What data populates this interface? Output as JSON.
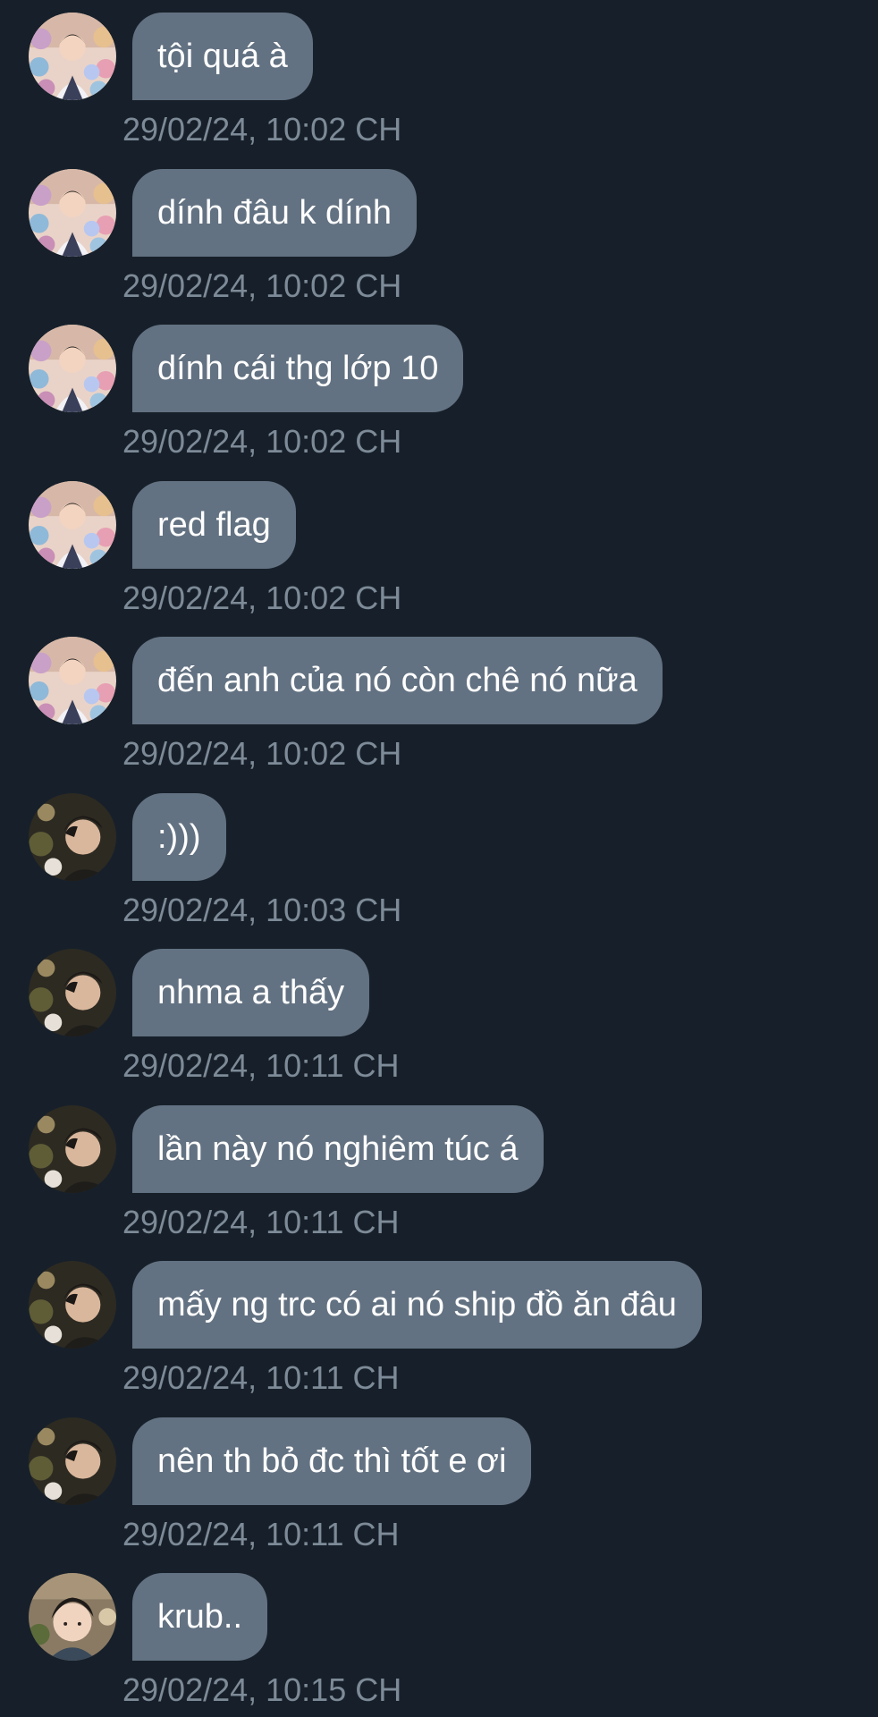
{
  "colors": {
    "background": "#17202a",
    "bubble": "#637282",
    "bubble_text": "#ffffff",
    "timestamp": "#7d8a97"
  },
  "messages": [
    {
      "avatar": "avatar-a",
      "text": "tội quá à",
      "time": "29/02/24, 10:02 CH"
    },
    {
      "avatar": "avatar-a",
      "text": "dính đâu k dính",
      "time": "29/02/24, 10:02 CH"
    },
    {
      "avatar": "avatar-a",
      "text": "dính cái thg lớp 10",
      "time": "29/02/24, 10:02 CH"
    },
    {
      "avatar": "avatar-a",
      "text": "red flag",
      "time": "29/02/24, 10:02 CH"
    },
    {
      "avatar": "avatar-a",
      "text": "đến anh của nó còn chê nó nữa",
      "time": "29/02/24, 10:02 CH"
    },
    {
      "avatar": "avatar-b",
      "text": ":)))",
      "time": "29/02/24, 10:03 CH"
    },
    {
      "avatar": "avatar-b",
      "text": "nhma a thấy",
      "time": "29/02/24, 10:11 CH"
    },
    {
      "avatar": "avatar-b",
      "text": "lần này nó nghiêm túc á",
      "time": "29/02/24, 10:11 CH"
    },
    {
      "avatar": "avatar-b",
      "text": "mấy ng trc có ai nó ship đồ ăn đâu",
      "time": "29/02/24, 10:11 CH"
    },
    {
      "avatar": "avatar-b",
      "text": "nên th bỏ đc thì tốt e ơi",
      "time": "29/02/24, 10:11 CH"
    },
    {
      "avatar": "avatar-c",
      "text": "krub..",
      "time": "29/02/24, 10:15 CH"
    }
  ]
}
